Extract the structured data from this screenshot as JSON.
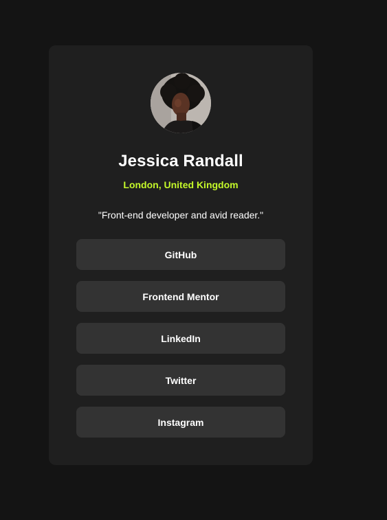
{
  "profile": {
    "avatar_alt": "Jessica Randall avatar",
    "name": "Jessica Randall",
    "location": "London, United Kingdom",
    "bio": "\"Front-end developer and avid reader.\""
  },
  "links": [
    {
      "label": "GitHub"
    },
    {
      "label": "Frontend Mentor"
    },
    {
      "label": "LinkedIn"
    },
    {
      "label": "Twitter"
    },
    {
      "label": "Instagram"
    }
  ],
  "colors": {
    "background": "#141414",
    "card": "#1f1f1f",
    "button": "#333333",
    "accent": "#c4f82a",
    "text": "#ffffff"
  }
}
